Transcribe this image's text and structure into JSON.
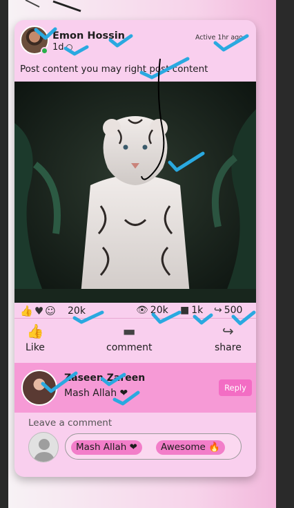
{
  "post": {
    "author": "Emon Hossin",
    "time": "1d",
    "active_status": "Active 1hr ago",
    "content": "Post content you may right post content"
  },
  "reactions": {
    "icons": [
      "thumbs-up-icon",
      "heart-icon",
      "smile-icon"
    ],
    "count": "20k",
    "views": "20k",
    "comments": "1k",
    "shares": "500"
  },
  "actions": {
    "like_label": "Like",
    "comment_label": "comment",
    "share_label": "share"
  },
  "comment": {
    "author": "Zaseen Zareen",
    "text": "Mash Allah ❤",
    "reply_label": "Reply"
  },
  "comment_input": {
    "placeholder": "Leave a comment",
    "quick_replies": [
      "Mash Allah ❤",
      "Awesome 🔥"
    ]
  },
  "colors": {
    "card": "#f9cfee",
    "comment_bg": "#f69ad6",
    "accent": "#f36dc4",
    "annotation_check": "#2aa9e0"
  }
}
